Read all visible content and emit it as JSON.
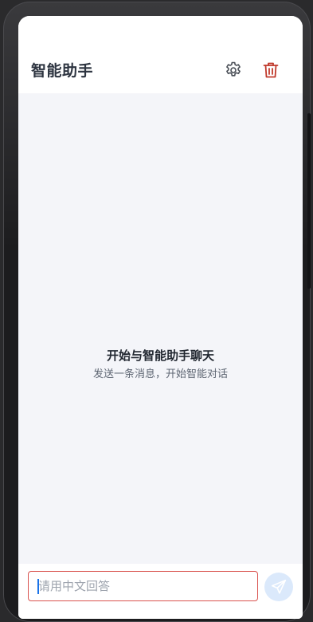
{
  "header": {
    "title": "智能助手",
    "settings_icon": "gear-icon",
    "delete_icon": "trash-icon"
  },
  "chat": {
    "empty_title": "开始与智能助手聊天",
    "empty_subtitle": "发送一条消息，开始智能对话"
  },
  "input": {
    "value": "",
    "placeholder": "请用中文回答",
    "send_icon": "send-icon"
  },
  "colors": {
    "title": "#2d3440",
    "delete_icon": "#c0392b",
    "settings_icon": "#4a4f57",
    "chat_background": "#f4f5f9",
    "input_border": "#d9534f",
    "send_button_bg": "#dbe9fb",
    "send_icon": "#ffffff"
  }
}
